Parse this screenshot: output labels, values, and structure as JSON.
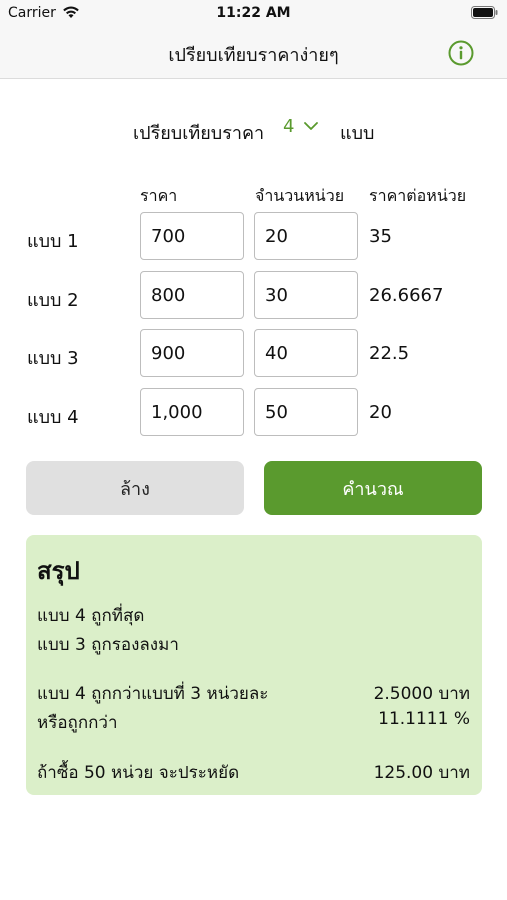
{
  "status_bar": {
    "carrier": "Carrier",
    "time": "11:22 AM"
  },
  "nav": {
    "title": "เปรียบเทียบราคาง่ายๆ",
    "info_icon": "info-circle-icon"
  },
  "compare": {
    "label": "เปรียบเทียบราคา",
    "selected_count": "4",
    "suffix": "แบบ"
  },
  "table": {
    "headers": {
      "price": "ราคา",
      "units": "จำนวนหน่วย",
      "unit_price": "ราคาต่อหน่วย"
    },
    "rows": [
      {
        "label": "แบบ 1",
        "price": "700",
        "units": "20",
        "unit_price": "35"
      },
      {
        "label": "แบบ 2",
        "price": "800",
        "units": "30",
        "unit_price": "26.6667"
      },
      {
        "label": "แบบ 3",
        "price": "900",
        "units": "40",
        "unit_price": "22.5"
      },
      {
        "label": "แบบ 4",
        "price": "1,000",
        "units": "50",
        "unit_price": "20"
      }
    ]
  },
  "buttons": {
    "clear": "ล้าง",
    "calculate": "คำนวณ"
  },
  "summary": {
    "title": "สรุป",
    "cheapest": "แบบ 4 ถูกที่สุด",
    "second": "แบบ 3 ถูกรองลงมา",
    "diff_label": "แบบ 4 ถูกกว่าแบบที่ 3 หน่วยละ",
    "diff_value": "2.5000 บาท",
    "percent_label": "หรือถูกกว่า",
    "percent_value": "11.1111 %",
    "saving_label": "ถ้าซื้อ 50 หน่วย จะประหยัด",
    "saving_value": "125.00 บาท"
  },
  "colors": {
    "accent": "#5a9a2e",
    "summary_bg": "#dbefc9",
    "clear_bg": "#e0e0e0"
  }
}
